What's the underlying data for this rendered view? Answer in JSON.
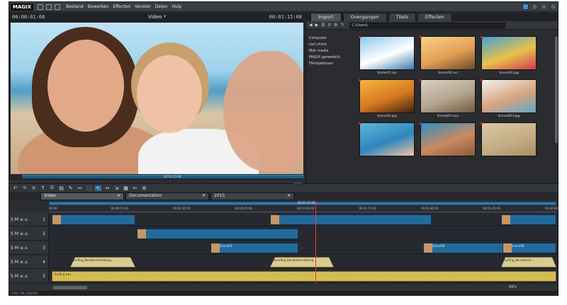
{
  "app": {
    "logo": "MAGIX",
    "menu": [
      "Bestand",
      "Bewerken",
      "Effecten",
      "Venster",
      "Delen",
      "Hulp"
    ]
  },
  "monitor": {
    "timecode_left": "00:00:01:08",
    "title": "Video *",
    "timecode_right": "00:01:15:08",
    "scrub_label": "00:01:15:08",
    "transport": [
      "[",
      "]",
      "⇤",
      "⏮",
      "■",
      "⇥",
      "⏭",
      "●",
      "⚡"
    ]
  },
  "pool": {
    "tabs": [
      "Import",
      "Overgangen",
      "Titels",
      "Effecten"
    ],
    "path": "C:\\Users\\",
    "folders": [
      "Computer",
      "carl.christ",
      "Mijn media",
      "MAGIX gereedsch.",
      "Filmsjablonen"
    ],
    "items": [
      {
        "name": "Scene01.avi",
        "colors": [
          "#8fc8ea",
          "#ffffff",
          "#3b7eb0"
        ]
      },
      {
        "name": "Scene02.avi",
        "colors": [
          "#f7d088",
          "#e3a055",
          "#6b4a2e"
        ]
      },
      {
        "name": "Scene03.jpg",
        "colors": [
          "#41a0d8",
          "#e8c24a",
          "#d23a55"
        ]
      },
      {
        "name": "Scene04.jpg",
        "colors": [
          "#f6b43c",
          "#d67a1f",
          "#3d230f"
        ]
      },
      {
        "name": "Scene05.mov",
        "colors": [
          "#d8d2c6",
          "#b4a48c",
          "#6d5a44"
        ]
      },
      {
        "name": "Scene06.mpg",
        "colors": [
          "#f2f2f2",
          "#d9a47f",
          "#5fa6c9"
        ]
      },
      {
        "name": "",
        "colors": [
          "#5fb6d9",
          "#2e86bd",
          "#f2c3a3"
        ]
      },
      {
        "name": "",
        "colors": [
          "#2f8fc4",
          "#c98a61",
          "#8a5a3c"
        ]
      },
      {
        "name": "",
        "colors": [
          "#d9c9a8",
          "#c5ae86",
          "#a88d66"
        ]
      }
    ]
  },
  "timeline": {
    "tools": [
      "↶",
      "↷",
      "✕",
      "T",
      "⌸",
      "▤",
      "✎",
      "⚯",
      "⬚",
      "↖",
      "↔",
      "⇲",
      "▦",
      "✄",
      "⊞"
    ],
    "sequences": [
      {
        "label": "Video",
        "active": true
      },
      {
        "label": "Documentation",
        "active": false
      },
      {
        "label": "2015",
        "active": false
      }
    ],
    "nav_label": "00:01:15:08",
    "ticks": [
      "00:00",
      "00:00:15:00",
      "00:00:30:00",
      "00:00:45:00",
      "00:01:00:00",
      "00:01:15:00",
      "00:01:30:00",
      "00:01:45:00",
      "00:02:00:00"
    ],
    "track_tools": [
      "S",
      "M",
      "≡",
      "⌂",
      "↻"
    ],
    "tracks": [
      "1",
      "2",
      "3",
      "4",
      "5"
    ],
    "clip_titles": {
      "t3a": "Scene03",
      "t3b": "Scene06",
      "t3c": "Scene08",
      "t4a": "Surfing_Bandbeschreibung...",
      "t4b": "Boarding_Bandbeschreibung...",
      "t4c": "Surfing_Bandbesch..."
    },
    "audio_label": "Surfing.wav",
    "zoom": "99%"
  },
  "status": "CPU: 0% (16/16)"
}
